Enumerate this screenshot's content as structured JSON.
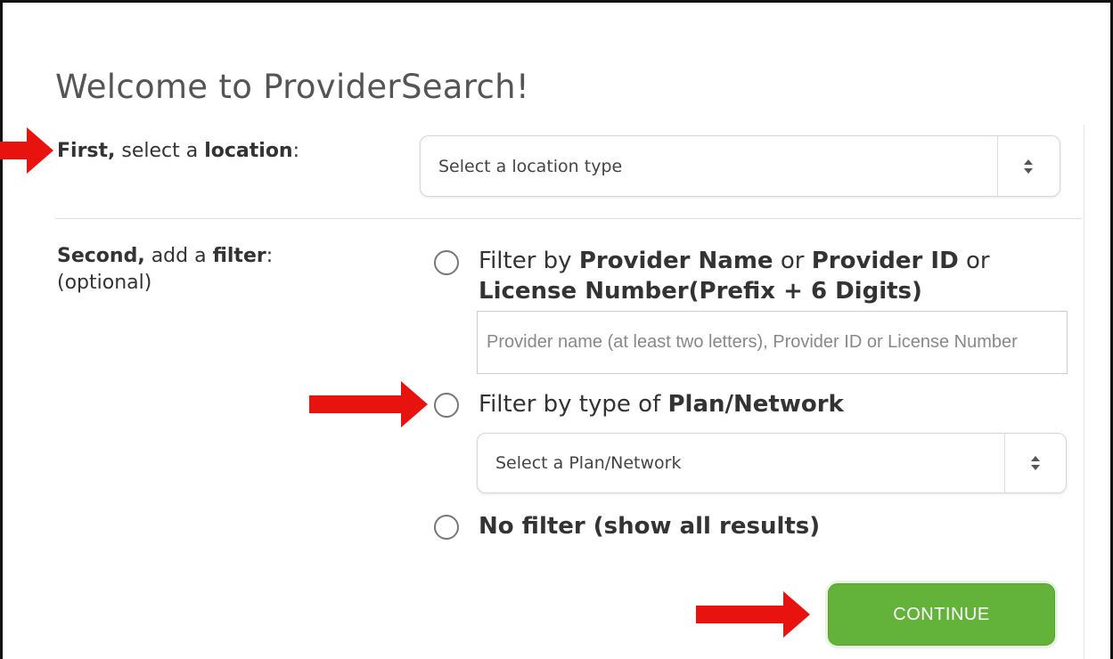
{
  "header": {
    "title": "Welcome to ProviderSearch!"
  },
  "location_step": {
    "label_bold_1": "First,",
    "label_text_1": " select a ",
    "label_bold_2": "location",
    "label_text_2": ":",
    "select_value": "Select a location type",
    "select_icon": "sort-updown-icon"
  },
  "filter_step": {
    "label_bold_1": "Second,",
    "label_text_1": " add a ",
    "label_bold_2": "filter",
    "label_text_2": ":",
    "optional_text": "(optional)",
    "options": [
      {
        "line1_text_1": "Filter by ",
        "line1_bold_1": "Provider Name",
        "line1_text_2": " or ",
        "line1_bold_2": "Provider ID",
        "line1_text_3": " or",
        "line2_bold": "License Number(Prefix + 6 Digits)",
        "input_placeholder": "Provider name (at least two letters), Provider ID or License Number",
        "input_value": ""
      },
      {
        "text": "Filter by type of ",
        "bold": "Plan/Network",
        "select_value": "Select a Plan/Network",
        "select_icon": "sort-updown-icon"
      },
      {
        "bold": "No filter (show all results)"
      }
    ]
  },
  "actions": {
    "continue_label": "CONTINUE"
  },
  "annotations": {
    "arrow_color": "#e8130e"
  },
  "colors": {
    "button_green": "#63b33a",
    "title_gray": "#555555"
  }
}
